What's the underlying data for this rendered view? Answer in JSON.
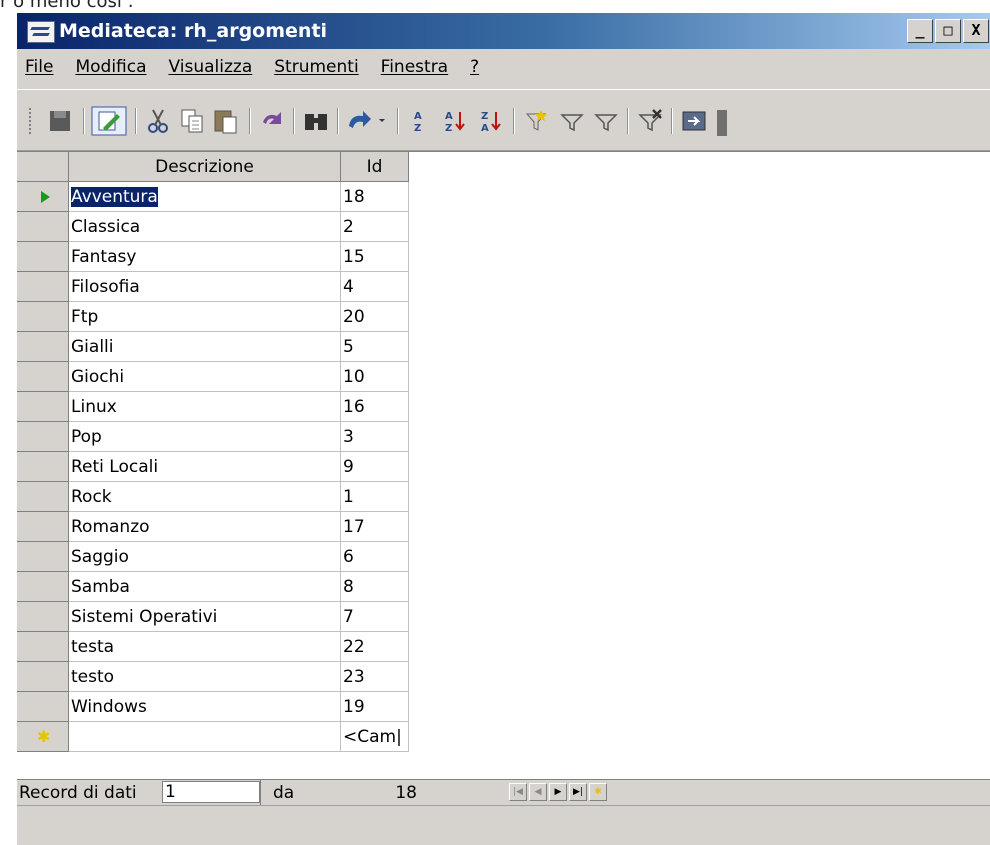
{
  "above_text": "r o meno così :",
  "window": {
    "title": "Mediateca: rh_argomenti",
    "buttons": [
      "_",
      "□",
      "X"
    ]
  },
  "menu": [
    "File",
    "Modifica",
    "Visualizza",
    "Strumenti",
    "Finestra",
    "?"
  ],
  "toolbar_icons": [
    "save-icon",
    "edit-icon",
    "cut-icon",
    "copy-icon",
    "paste-icon",
    "undo-icon",
    "find-icon",
    "redo-icon",
    "sort-icon",
    "sort-ascending-icon",
    "sort-descending-icon",
    "autofilter-icon",
    "filter-icon",
    "standard-filter-icon",
    "remove-filter-icon",
    "data-to-text-icon"
  ],
  "grid": {
    "columns": [
      "Descrizione",
      "Id"
    ],
    "rows": [
      {
        "desc": "Avventura",
        "id": "18"
      },
      {
        "desc": "Classica",
        "id": "2"
      },
      {
        "desc": "Fantasy",
        "id": "15"
      },
      {
        "desc": "Filosofia",
        "id": "4"
      },
      {
        "desc": "Ftp",
        "id": "20"
      },
      {
        "desc": "Gialli",
        "id": "5"
      },
      {
        "desc": "Giochi",
        "id": "10"
      },
      {
        "desc": "Linux",
        "id": "16"
      },
      {
        "desc": "Pop",
        "id": "3"
      },
      {
        "desc": "Reti Locali",
        "id": "9"
      },
      {
        "desc": "Rock",
        "id": "1"
      },
      {
        "desc": "Romanzo",
        "id": "17"
      },
      {
        "desc": "Saggio",
        "id": "6"
      },
      {
        "desc": "Samba",
        "id": "8"
      },
      {
        "desc": "Sistemi Operativi",
        "id": "7"
      },
      {
        "desc": "testa",
        "id": "22"
      },
      {
        "desc": "testo",
        "id": "23"
      },
      {
        "desc": "Windows",
        "id": "19"
      }
    ],
    "new_row_id": "<Cam|"
  },
  "nav": {
    "label": "Record di dati",
    "current": "1",
    "of_label": "da",
    "total": "18"
  }
}
